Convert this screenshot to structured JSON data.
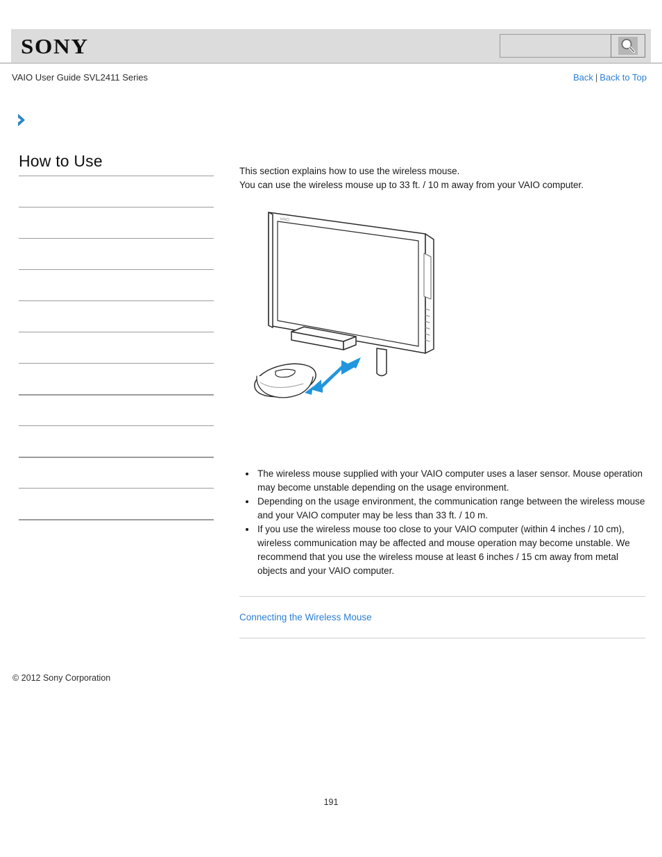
{
  "header": {
    "brand": "SONY",
    "search": {
      "value": "",
      "placeholder": "",
      "icon": "search-icon",
      "button_label": ""
    }
  },
  "breadcrumb": {
    "title": "VAIO User Guide SVL2411 Series",
    "back_label": "Back",
    "separator": "|",
    "back_to_top_label": "Back to Top"
  },
  "sidebar": {
    "chevron_icon": "chevron-right-icon",
    "title": "How to Use",
    "items": [
      {
        "label": ""
      },
      {
        "label": ""
      },
      {
        "label": ""
      },
      {
        "label": ""
      },
      {
        "label": ""
      },
      {
        "label": ""
      },
      {
        "label": ""
      },
      {
        "label": ""
      },
      {
        "label": ""
      },
      {
        "label": ""
      },
      {
        "label": ""
      },
      {
        "label": ""
      }
    ]
  },
  "main": {
    "intro": [
      "This section explains how to use the wireless mouse.",
      "You can use the wireless mouse up to 33 ft. / 10 m away from your VAIO computer."
    ],
    "figure": {
      "name": "wireless-mouse-range-illustration",
      "monitor_logo": "VAIO",
      "arrow_color": "#2196dd"
    },
    "notes": [
      "The wireless mouse supplied with your VAIO computer uses a laser sensor. Mouse operation may become unstable depending on the usage environment.",
      "Depending on the usage environment, the communication range between the wireless mouse and your VAIO computer may be less than 33 ft. / 10 m.",
      "If you use the wireless mouse too close to your VAIO computer (within 4 inches / 10 cm), wireless communication may be affected and mouse operation may become unstable. We recommend that you use the wireless mouse at least 6 inches / 15 cm away from metal objects and your VAIO computer."
    ],
    "related_link": "Connecting the Wireless Mouse"
  },
  "footer": {
    "copyright": "© 2012 Sony Corporation",
    "page_number": "191"
  },
  "colors": {
    "link": "#2b7fd4",
    "header_band": "#dcdcdc",
    "rule": "#9b9b9b",
    "accent_blue": "#2196dd"
  }
}
